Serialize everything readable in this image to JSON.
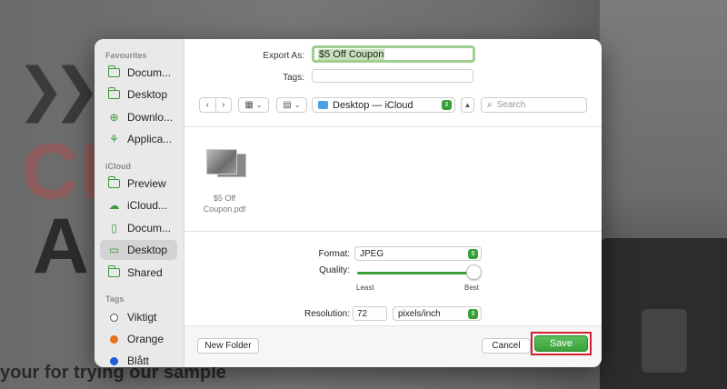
{
  "background": {
    "tagline": "your for trying our sample",
    "letters_top": "CIN",
    "letters_bottom": "AC"
  },
  "sidebar": {
    "favourites_header": "Favourites",
    "favourites": [
      {
        "label": "Docum...",
        "icon": "folder-icon"
      },
      {
        "label": "Desktop",
        "icon": "folder-icon"
      },
      {
        "label": "Downlo...",
        "icon": "download-icon"
      },
      {
        "label": "Applica...",
        "icon": "applications-icon"
      }
    ],
    "icloud_header": "iCloud",
    "icloud": [
      {
        "label": "Preview",
        "icon": "folder-icon"
      },
      {
        "label": "iCloud...",
        "icon": "cloud-icon"
      },
      {
        "label": "Docum...",
        "icon": "document-icon"
      },
      {
        "label": "Desktop",
        "icon": "desktop-icon",
        "selected": true
      },
      {
        "label": "Shared",
        "icon": "shared-folder-icon"
      }
    ],
    "tags_header": "Tags",
    "tags": [
      {
        "label": "Viktigt",
        "color": "#ffffff"
      },
      {
        "label": "Orange",
        "color": "#e8731e"
      },
      {
        "label": "Blått",
        "color": "#1f5ed8"
      }
    ]
  },
  "export": {
    "export_as_label": "Export As:",
    "export_as_value": "$5 Off Coupon",
    "tags_label": "Tags:",
    "tags_value": ""
  },
  "toolbar": {
    "location": "Desktop — iCloud",
    "search_placeholder": "Search"
  },
  "files": [
    {
      "name": "$5 Off Coupon.pdf"
    }
  ],
  "options": {
    "format_label": "Format:",
    "format_value": "JPEG",
    "quality_label": "Quality:",
    "quality_level": 0.95,
    "quality_min_label": "Least",
    "quality_max_label": "Best",
    "resolution_label": "Resolution:",
    "resolution_value": "72",
    "resolution_unit": "pixels/inch"
  },
  "footer": {
    "new_folder_label": "New Folder",
    "cancel_label": "Cancel",
    "save_label": "Save"
  },
  "colors": {
    "accent": "#3aa03a",
    "highlight_outline": "#d2202f"
  }
}
